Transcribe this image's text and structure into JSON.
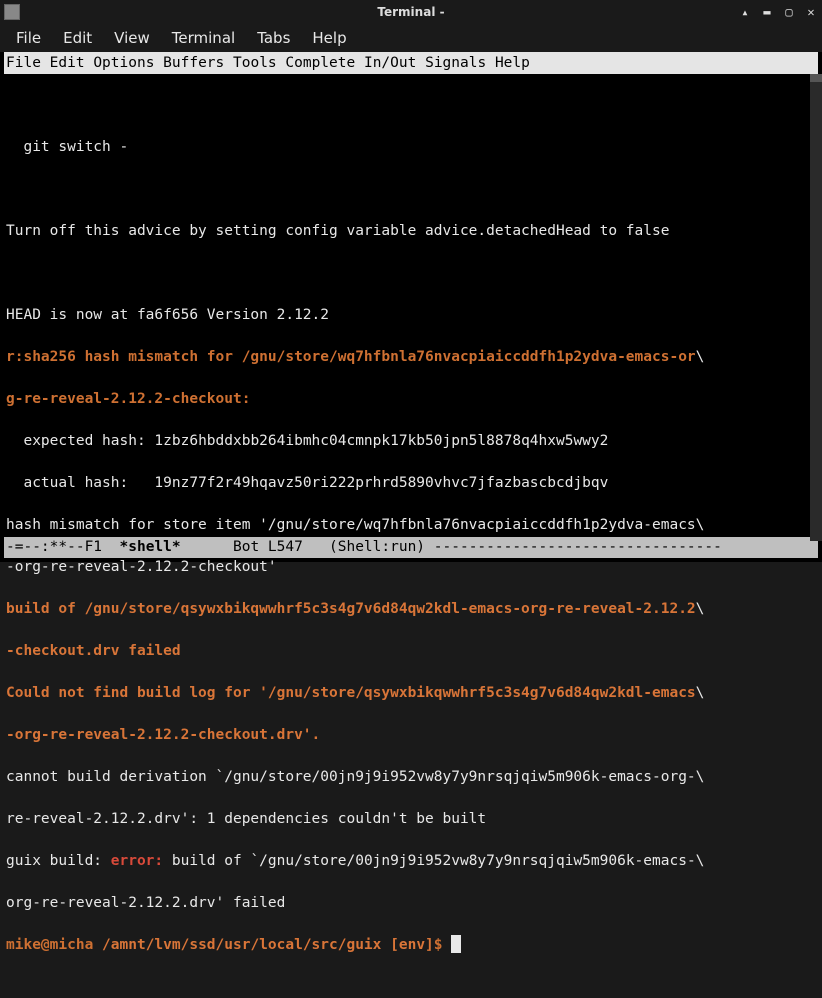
{
  "window": {
    "title": "Terminal -"
  },
  "menubar": {
    "file": "File",
    "edit": "Edit",
    "view": "View",
    "terminal": "Terminal",
    "tabs": "Tabs",
    "help": "Help"
  },
  "emacs_menu": {
    "file": "File",
    "edit": "Edit",
    "options": "Options",
    "buffers": "Buffers",
    "tools": "Tools",
    "complete": "Complete",
    "inout": "In/Out",
    "signals": "Signals",
    "help": "Help"
  },
  "content": {
    "l1": "  git switch -",
    "l2": "Turn off this advice by setting config variable advice.detachedHead to false",
    "l3": "HEAD is now at fa6f656 Version 2.12.2",
    "l4a": "r:sha256 hash mismatch for /gnu/store/wq7hfbnla76nvacpiaiccddfh1p2ydva-emacs-or",
    "l4b": "\\",
    "l5": "g-re-reveal-2.12.2-checkout:",
    "l6": "  expected hash: 1zbz6hbddxbb264ibmhc04cmnpk17kb50jpn5l8878q4hxw5wwy2",
    "l7": "  actual hash:   19nz77f2r49hqavz50ri222prhrd5890vhvc7jfazbascbcdjbqv",
    "l8": "hash mismatch for store item '/gnu/store/wq7hfbnla76nvacpiaiccddfh1p2ydva-emacs\\",
    "l9": "-org-re-reveal-2.12.2-checkout'",
    "l10a": "build of /gnu/store/qsywxbikqwwhrf5c3s4g7v6d84qw2kdl-emacs-org-re-reveal-2.12.2",
    "l10b": "\\",
    "l11": "-checkout.drv failed",
    "l12a": "Could not find build log for '/gnu/store/qsywxbikqwwhrf5c3s4g7v6d84qw2kdl-emacs",
    "l12b": "\\",
    "l13": "-org-re-reveal-2.12.2-checkout.drv'.",
    "l14": "cannot build derivation `/gnu/store/00jn9j9i952vw8y7y9nrsqjqiw5m906k-emacs-org-\\",
    "l15": "re-reveal-2.12.2.drv': 1 dependencies couldn't be built",
    "l16a": "guix build: ",
    "l16b": "error:",
    "l16c": " build of `/gnu/store/00jn9j9i952vw8y7y9nrsqjqiw5m906k-emacs-\\",
    "l17": "org-re-reveal-2.12.2.drv' failed",
    "prompt_user": "mike@micha",
    "prompt_path": " /amnt/lvm/ssd/usr/local/src/guix [env]",
    "prompt_symbol": "$ "
  },
  "modeline": {
    "left": "-=--:**--F1  ",
    "buffer": "*shell*",
    "right": "      Bot L547   (Shell:run) ---------------------------------"
  }
}
